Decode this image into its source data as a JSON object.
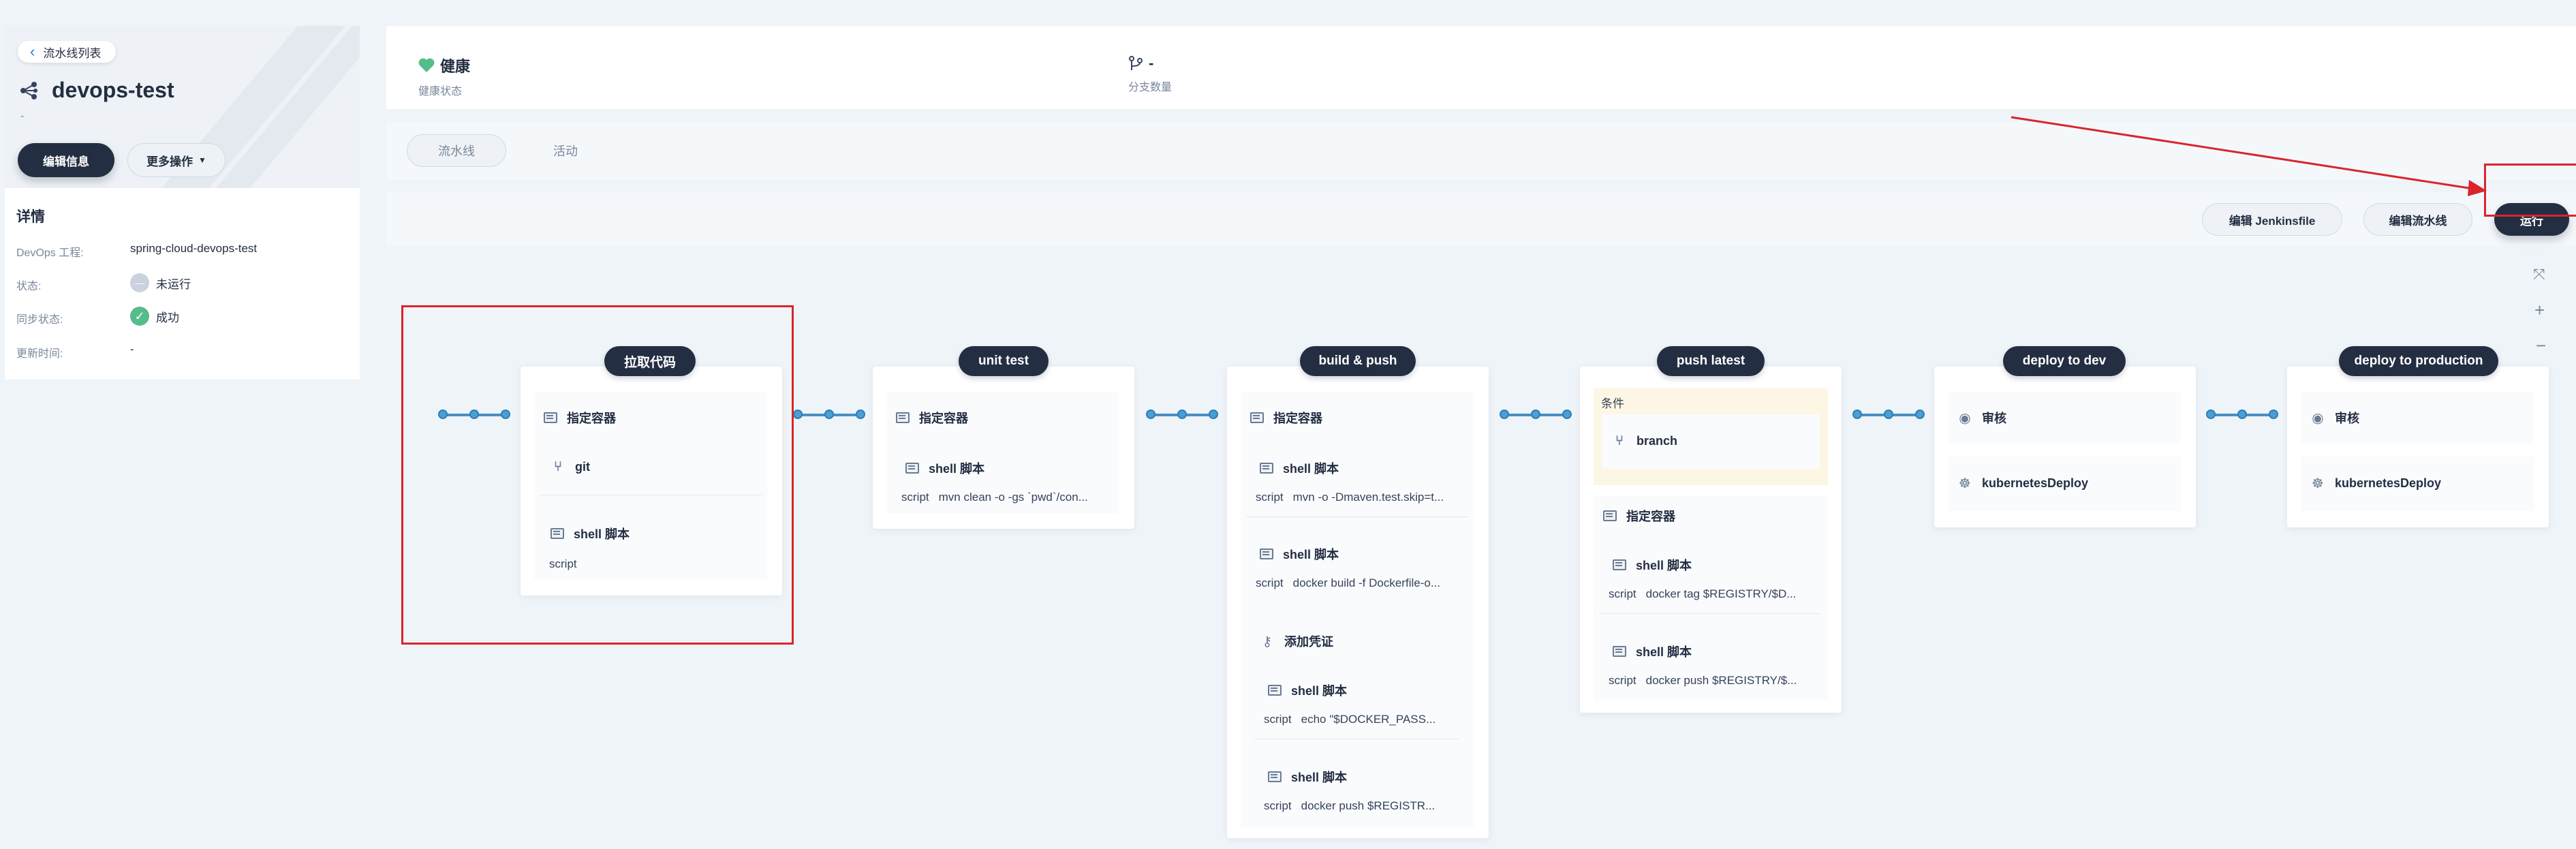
{
  "sidebar": {
    "back_label": "流水线列表",
    "project_name": "devops-test",
    "project_desc": "-",
    "edit_info": "编辑信息",
    "more_ops": "更多操作",
    "detail_title": "详情",
    "details": [
      {
        "label": "DevOps 工程:",
        "value": "spring-cloud-devops-test"
      },
      {
        "label": "状态:",
        "value": "未运行"
      },
      {
        "label": "同步状态:",
        "value": "成功"
      },
      {
        "label": "更新时间:",
        "value": "-"
      }
    ]
  },
  "stats": {
    "health_value": "健康",
    "health_label": "健康状态",
    "branch_value": "-",
    "branch_label": "分支数量"
  },
  "tabs": [
    {
      "label": "流水线",
      "active": true
    },
    {
      "label": "活动",
      "active": false
    }
  ],
  "toolbar": {
    "edit_jenkinsfile": "编辑 Jenkinsfile",
    "edit_pipeline": "编辑流水线",
    "run": "运行"
  },
  "pipeline": {
    "stages": [
      {
        "title": "拉取代码",
        "container": "指定容器",
        "git": "git",
        "shell": "shell 脚本",
        "script": "script"
      },
      {
        "title": "unit test",
        "container": "指定容器",
        "shell": "shell 脚本",
        "script_label": "script",
        "script": "mvn clean -o -gs `pwd`/con..."
      },
      {
        "title": "build & push",
        "container": "指定容器",
        "steps": [
          {
            "shell": "shell 脚本",
            "script_label": "script",
            "script": "mvn -o -Dmaven.test.skip=t..."
          },
          {
            "shell": "shell 脚本",
            "script_label": "script",
            "script": "docker build -f Dockerfile-o..."
          }
        ],
        "credential": "添加凭证",
        "cred_steps": [
          {
            "shell": "shell 脚本",
            "script_label": "script",
            "script": "echo \"$DOCKER_PASS..."
          },
          {
            "shell": "shell 脚本",
            "script_label": "script",
            "script": "docker push $REGISTR..."
          }
        ]
      },
      {
        "title": "push latest",
        "condition": "条件",
        "branch": "branch",
        "container": "指定容器",
        "steps": [
          {
            "shell": "shell 脚本",
            "script_label": "script",
            "script": "docker tag $REGISTRY/$D..."
          },
          {
            "shell": "shell 脚本",
            "script_label": "script",
            "script": "docker push $REGISTRY/$..."
          }
        ]
      },
      {
        "title": "deploy to dev",
        "review": "审核",
        "deploy": "kubernetesDeploy"
      },
      {
        "title": "deploy to production",
        "review": "审核",
        "deploy": "kubernetesDeploy"
      }
    ]
  },
  "colors": {
    "primary_dark": "#242e42",
    "success": "#55bc8a",
    "annotation_red": "#d9252b",
    "node_blue": "#4a9fd4"
  }
}
